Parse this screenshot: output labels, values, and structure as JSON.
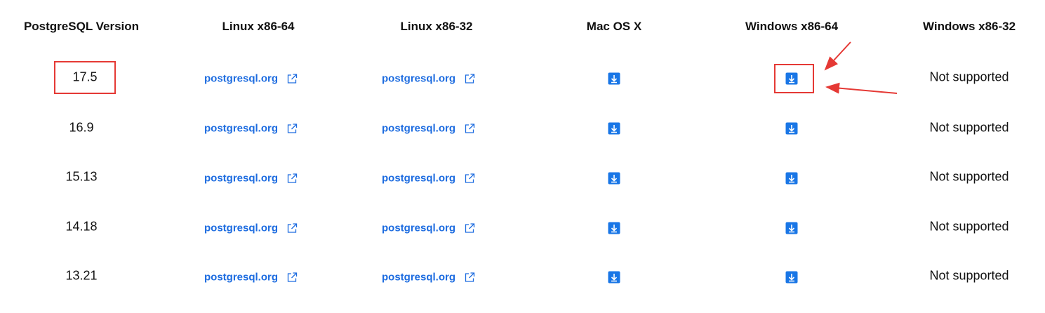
{
  "table": {
    "headers": {
      "version": "PostgreSQL Version",
      "linux64": "Linux x86-64",
      "linux32": "Linux x86-32",
      "mac": "Mac OS X",
      "win64": "Windows x86-64",
      "win32": "Windows x86-32"
    },
    "rows": [
      {
        "version": "17.5",
        "linux64": "postgresql.org",
        "linux32": "postgresql.org",
        "win32": "Not supported"
      },
      {
        "version": "16.9",
        "linux64": "postgresql.org",
        "linux32": "postgresql.org",
        "win32": "Not supported"
      },
      {
        "version": "15.13",
        "linux64": "postgresql.org",
        "linux32": "postgresql.org",
        "win32": "Not supported"
      },
      {
        "version": "14.18",
        "linux64": "postgresql.org",
        "linux32": "postgresql.org",
        "win32": "Not supported"
      },
      {
        "version": "13.21",
        "linux64": "postgresql.org",
        "linux32": "postgresql.org",
        "win32": "Not supported"
      }
    ]
  },
  "icons": {
    "external": "external-link-icon",
    "download": "download-icon"
  },
  "colors": {
    "link": "#1d6ce0",
    "download_bg": "#1976e6",
    "annotation": "#e53935"
  }
}
